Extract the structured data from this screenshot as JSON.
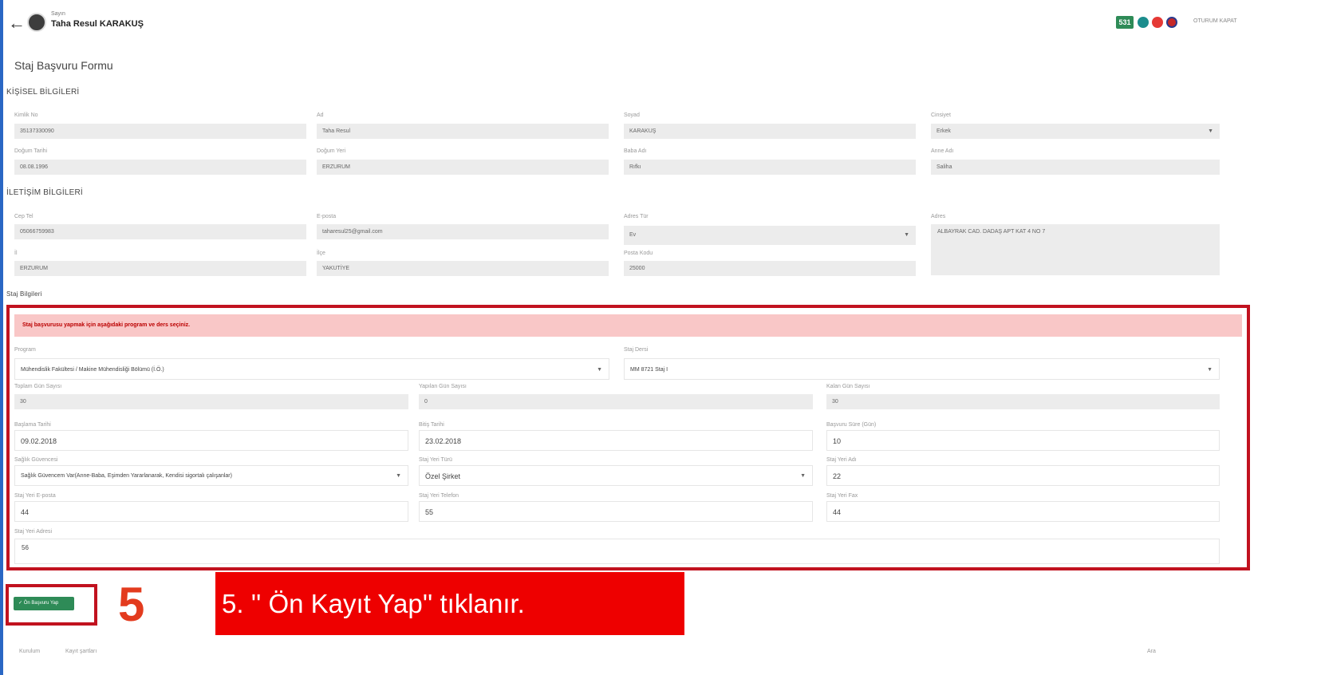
{
  "header": {
    "greeting": "Sayın",
    "user_name": "Taha Resul KARAKUŞ",
    "badge_count": "531",
    "logout_label": "OTURUM KAPAT"
  },
  "page": {
    "title": "Staj Başvuru Formu"
  },
  "personal": {
    "heading": "KİŞİSEL BİLGİLERİ",
    "tc_label": "Kimlik No",
    "tc_value": "35137330090",
    "name_label": "Ad",
    "name_value": "Taha Resul",
    "surname_label": "Soyad",
    "surname_value": "KARAKUŞ",
    "gender_label": "Cinsiyet",
    "gender_value": "Erkek",
    "birthdate_label": "Doğum Tarihi",
    "birthdate_value": "08.08.1996",
    "birthplace_label": "Doğum Yeri",
    "birthplace_value": "ERZURUM",
    "father_label": "Baba Adı",
    "father_value": "Rıfkı",
    "mother_label": "Anne Adı",
    "mother_value": "Saliha"
  },
  "contact": {
    "heading": "İLETİŞİM BİLGİLERİ",
    "phone_label": "Cep Tel",
    "phone_value": "05066759983",
    "email_label": "E-posta",
    "email_value": "taharesul25@gmail.com",
    "address_type_label": "Adres Tür",
    "address_type_value": "Ev",
    "address_label": "Adres",
    "address_value": "ALBAYRAK CAD. DADAŞ APT KAT 4 NO 7",
    "city_label": "İl",
    "city_value": "ERZURUM",
    "district_label": "İlçe",
    "district_value": "YAKUTİYE",
    "postal_label": "Posta Kodu",
    "postal_value": "25000"
  },
  "internship": {
    "heading": "Staj Bilgileri",
    "alert": "Staj başvurusu yapmak için aşağıdaki program ve ders seçiniz.",
    "program_label": "Program",
    "program_value": "Mühendislik Fakültesi / Makine Mühendisliği Bölümü (İ.Ö.)",
    "course_label": "Staj Dersi",
    "course_value": "MM 8721 Staj I",
    "total_days_label": "Toplam Gün Sayısı",
    "total_days_value": "30",
    "done_days_label": "Yapılan Gün Sayısı",
    "done_days_value": "0",
    "remaining_days_label": "Kalan Gün Sayısı",
    "remaining_days_value": "30",
    "start_label": "Başlama Tarihi",
    "start_value": "09.02.2018",
    "end_label": "Bitiş Tarihi",
    "end_value": "23.02.2018",
    "apply_days_label": "Başvuru Süre (Gün)",
    "apply_days_value": "10",
    "insurance_label": "Sağlık Güvencesi",
    "insurance_value": "Sağlık Güvencem Var(Anne-Baba, Eşimden Yararlanarak, Kendisi sigortalı çalışanlar)",
    "place_type_label": "Staj Yeri Türü",
    "place_type_value": "Özel Şirket",
    "place_name_label": "Staj Yeri Adı",
    "place_name_value": "22",
    "place_email_label": "Staj Yeri E-posta",
    "place_email_value": "44",
    "place_phone_label": "Staj Yeri Telefon",
    "place_phone_value": "55",
    "place_fax_label": "Staj Yeri Fax",
    "place_fax_value": "44",
    "place_address_label": "Staj Yeri Adresi",
    "place_address_value": "56"
  },
  "footer": {
    "submit_label": "Ön Başvuru Yap",
    "step_number": "5",
    "instruction": "5. '' Ön Kayıt Yap'' tıklanır.",
    "bottom_left": "Kurulum",
    "bottom_mid": "Kayıt şartları",
    "bottom_right": "Ara"
  },
  "colors": {
    "highlight_red": "#c1121f",
    "success_green": "#2e8b57",
    "alert_bg": "#f9c7c7"
  }
}
